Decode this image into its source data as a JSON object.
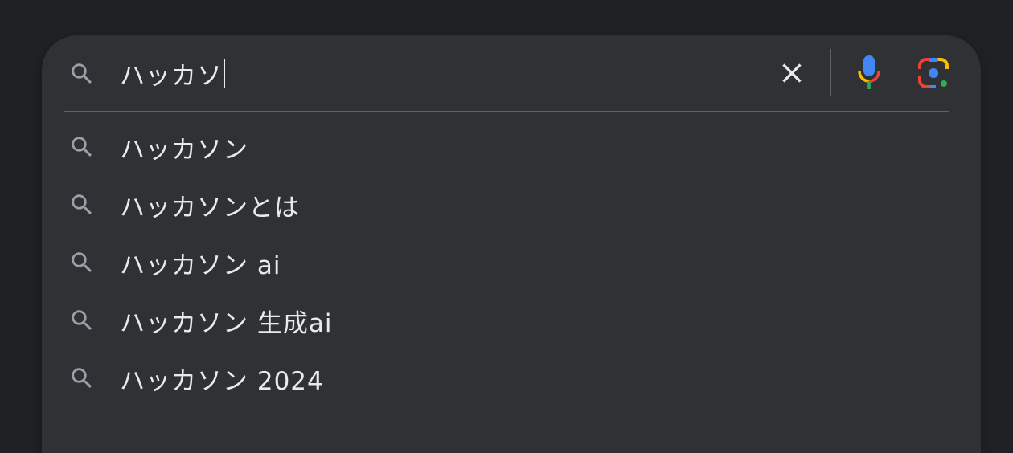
{
  "search": {
    "query": "ハッカソ",
    "icons": {
      "search": "search-icon",
      "clear": "close-icon",
      "voice": "microphone-icon",
      "lens": "google-lens-icon"
    }
  },
  "suggestions": [
    {
      "text": "ハッカソン",
      "icon": "search-icon"
    },
    {
      "text": "ハッカソンとは",
      "icon": "search-icon"
    },
    {
      "text": "ハッカソン ai",
      "icon": "search-icon"
    },
    {
      "text": "ハッカソン 生成ai",
      "icon": "search-icon"
    },
    {
      "text": "ハッカソン 2024",
      "icon": "search-icon"
    }
  ],
  "colors": {
    "page_background": "#202124",
    "panel_background": "#303134",
    "text": "#e8eaed",
    "icon_gray": "#9aa0a6",
    "divider": "#5f6368",
    "google_blue": "#4285f4",
    "google_red": "#ea4335",
    "google_yellow": "#fbbc04",
    "google_green": "#34a853"
  }
}
